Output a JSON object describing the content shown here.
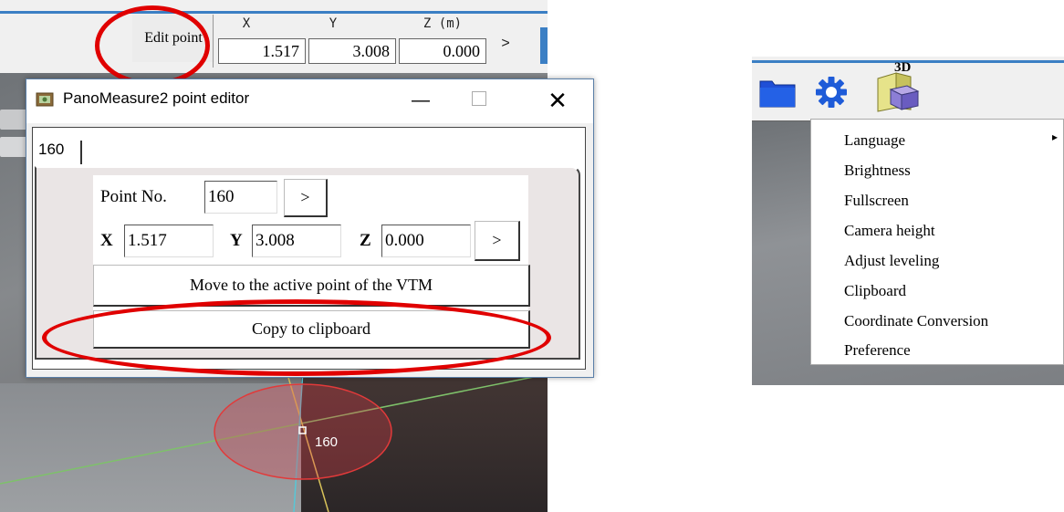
{
  "toolbar": {
    "edit_point_label": "Edit point",
    "coord_headers": {
      "x": "X",
      "y": "Y",
      "z": "Z (m)"
    },
    "coords": {
      "x": "1.517",
      "y": "3.008",
      "z": "0.000"
    },
    "next_label": ">"
  },
  "viewport": {
    "point_label": "160"
  },
  "dialog": {
    "title": "PanoMeasure2 point editor",
    "minimize": "—",
    "close": "✕",
    "tab_label": "160",
    "point_no_label": "Point No.",
    "point_no_value": "160",
    "point_next": ">",
    "x_label": "X",
    "x_value": "1.517",
    "y_label": "Y",
    "y_value": "3.008",
    "z_label": "Z",
    "z_value": "0.000",
    "coord_next": ">",
    "move_button": "Move to the active point of the VTM",
    "copy_button": "Copy to clipboard"
  },
  "settings_panel": {
    "toolbar_icons": [
      "folder-icon",
      "gear-icon",
      "3d-view-icon"
    ],
    "icon_3d_text": "3D",
    "menu": [
      {
        "label": "Language",
        "has_submenu": true
      },
      {
        "label": "Brightness"
      },
      {
        "label": "Fullscreen"
      },
      {
        "label": "Camera height"
      },
      {
        "label": "Adjust leveling"
      },
      {
        "label": "Clipboard"
      },
      {
        "label": "Coordinate Conversion"
      },
      {
        "label": "Preference"
      }
    ],
    "submenu_arrow": "▸"
  },
  "colors": {
    "annotation_red": "#e00000",
    "accent_blue": "#3b7fc4",
    "folder_blue": "#1f4fd6"
  }
}
